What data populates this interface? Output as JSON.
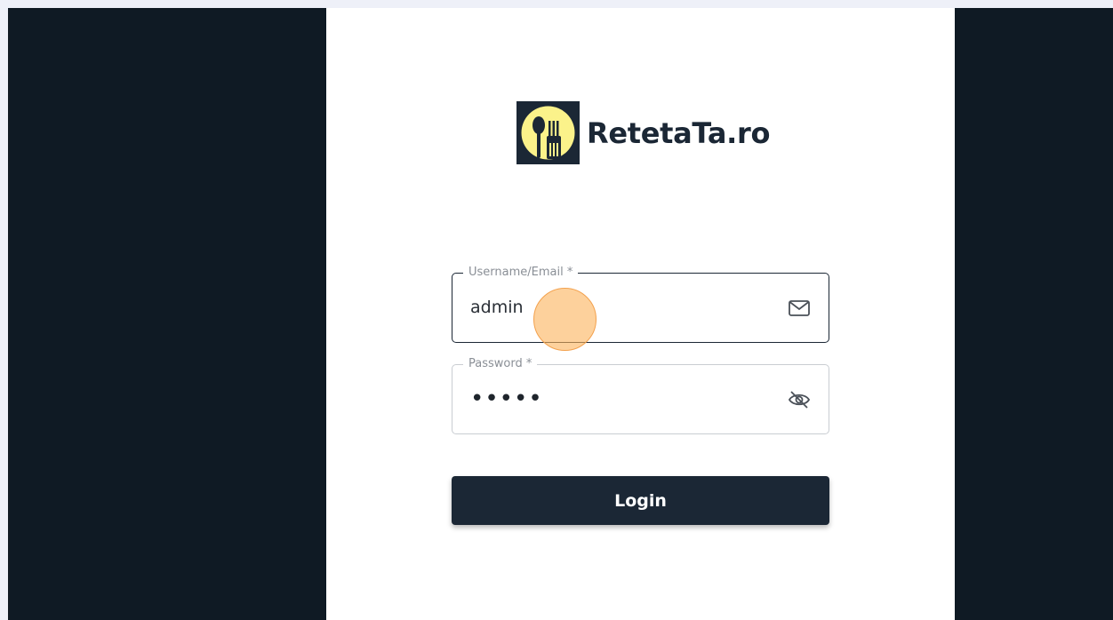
{
  "brand": {
    "name": "RetetaTa.ro",
    "logo_icon": "spoon-fork-logo",
    "logo_bg": "#1b2735",
    "logo_accent": "#fbf28a"
  },
  "form": {
    "username": {
      "label": "Username/Email *",
      "value": "admin",
      "icon": "mail-icon"
    },
    "password": {
      "label": "Password *",
      "value": "•••••",
      "icon": "eye-off-icon"
    },
    "login_label": "Login"
  },
  "colors": {
    "primary": "#1b2735",
    "page_bg": "#0f1a24",
    "panel_bg": "#ffffff",
    "cursor_highlight": "#fbb25a"
  }
}
